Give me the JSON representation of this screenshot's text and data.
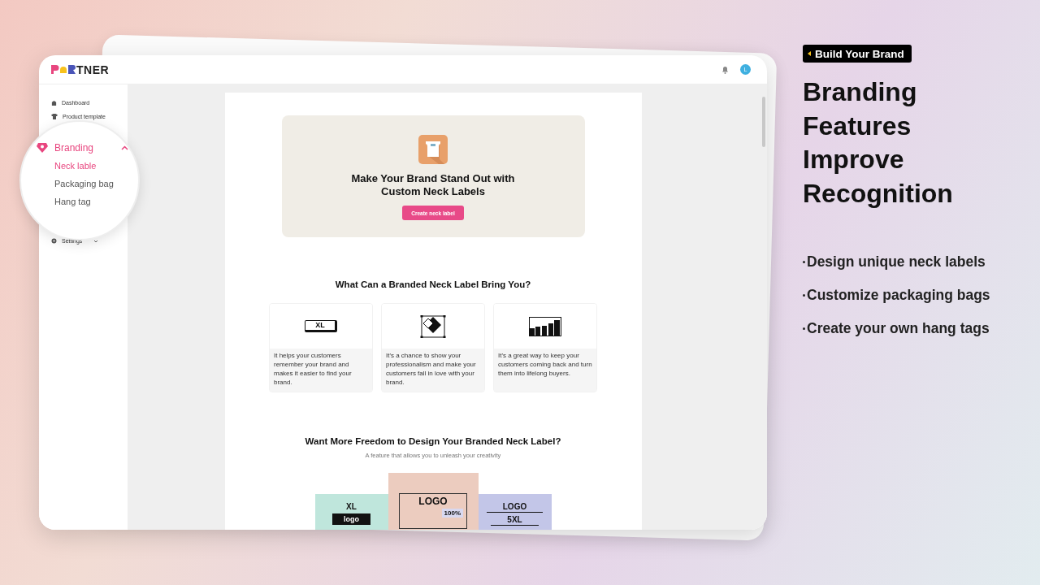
{
  "app": {
    "logo_text": "TNER",
    "notifications": {
      "has_badge": false
    },
    "avatar": "L"
  },
  "sidebar": {
    "items": [
      {
        "label": "Dashboard",
        "kind": "home"
      },
      {
        "label": "Product template",
        "kind": "shirt"
      }
    ],
    "magnified_group": {
      "label": "Branding",
      "expanded": true,
      "children": [
        {
          "label": "Neck lable",
          "selected": true
        },
        {
          "label": "Packaging bag",
          "selected": false
        },
        {
          "label": "Hang tag",
          "selected": false
        }
      ]
    },
    "bottom_items": [
      {
        "label": "Settings",
        "kind": "gear",
        "expanded": false
      }
    ]
  },
  "hero": {
    "title": "Make Your Brand Stand Out with Custom Neck Labels",
    "button": "Create neck label"
  },
  "benefits": {
    "title": "What Can a Branded Neck Label Bring You?",
    "cards": [
      {
        "kind": "tag",
        "icon_text": "XL",
        "text": "It helps your customers remember your brand and makes it easier to find your brand."
      },
      {
        "kind": "diamond",
        "text": "It's a chance to show your professionalism and make your customers fall in love with your brand."
      },
      {
        "kind": "bars",
        "text": "It's a great way to keep your customers coming back and turn them into lifelong buyers."
      }
    ]
  },
  "freedom": {
    "title": "Want More Freedom to Design Your Branded Neck Label?",
    "subtitle": "A feature that allows you to unleash your creativity",
    "samples": [
      {
        "color": "#bfe6dc",
        "texts": [
          "XL",
          "logo"
        ]
      },
      {
        "color": "#ecccbf",
        "texts": [
          "LOGO",
          "100%"
        ]
      },
      {
        "color": "#c3c6e8",
        "texts": [
          "LOGO",
          "5XL"
        ]
      }
    ]
  },
  "promo": {
    "badge": "Build Your Brand",
    "title": "Branding Features Improve Recognition",
    "bullets": [
      "Design unique neck labels",
      "Customize packaging bags",
      "Create your own hang tags"
    ]
  }
}
